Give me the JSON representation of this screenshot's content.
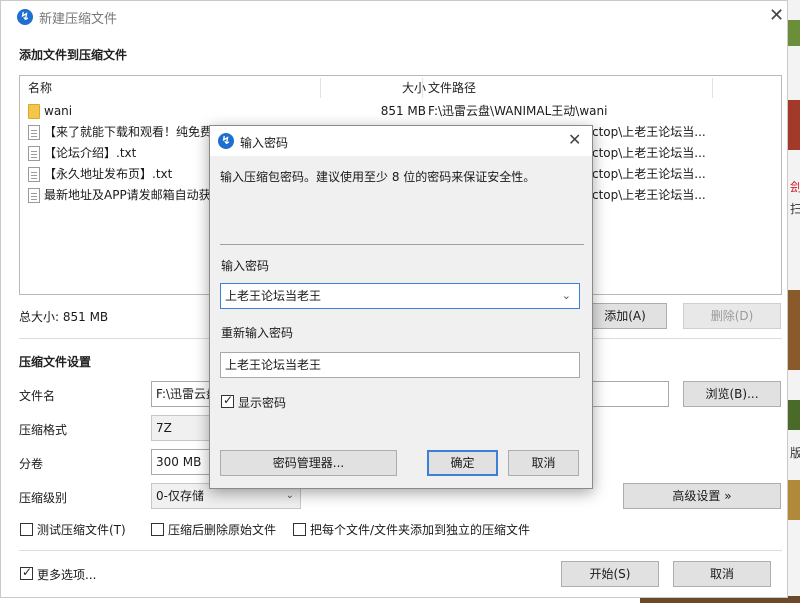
{
  "window": {
    "title": "新建压缩文件",
    "add_section_title": "添加文件到压缩文件"
  },
  "file_list": {
    "columns": [
      "名称",
      "大小",
      "文件路径"
    ],
    "rows": [
      {
        "name": "wani",
        "size": "851 MB",
        "path": "F:\\迅雷云盘\\WANIMAL王动\\wani",
        "type": "folder"
      },
      {
        "name": "【来了就能下载和观看！纯免费",
        "size": "",
        "path": "ctop\\上老王论坛当...",
        "type": "file"
      },
      {
        "name": "【论坛介绍】.txt",
        "size": "",
        "path": "ctop\\上老王论坛当...",
        "type": "file"
      },
      {
        "name": "【永久地址发布页】.txt",
        "size": "",
        "path": "ctop\\上老王论坛当...",
        "type": "file"
      },
      {
        "name": "最新地址及APP请发邮箱自动获",
        "size": "",
        "path": "ctop\\上老王论坛当...",
        "type": "file"
      }
    ]
  },
  "total_size": "总大小: 851 MB",
  "buttons": {
    "add": "添加(A)",
    "delete": "删除(D)",
    "browse": "浏览(B)...",
    "advanced": "高级设置 »",
    "start": "开始(S)",
    "cancel": "取消"
  },
  "settings": {
    "section_title": "压缩文件设置",
    "filename_label": "文件名",
    "filename_value": "F:\\迅雷云盘",
    "format_label": "压缩格式",
    "format_value": "7Z",
    "volume_label": "分卷",
    "volume_value": "300 MB",
    "level_label": "压缩级别",
    "level_value": "0-仅存储"
  },
  "options": {
    "test": {
      "label": "测试压缩文件(T)",
      "checked": false
    },
    "delete_source": {
      "label": "压缩后删除原始文件",
      "checked": false
    },
    "separate": {
      "label": "把每个文件/文件夹添加到独立的压缩文件",
      "checked": false
    },
    "more": {
      "label": "更多选项...",
      "checked": true
    }
  },
  "password_dialog": {
    "title": "输入密码",
    "instruction": "输入压缩包密码。建议使用至少 8 位的密码来保证安全性。",
    "password_label": "输入密码",
    "password_value": "上老王论坛当老王",
    "reenter_label": "重新输入密码",
    "reenter_value": "上老王论坛当老王",
    "show_password_label": "显示密码",
    "show_password_checked": true,
    "manager_button": "密码管理器...",
    "ok_button": "确定",
    "cancel_button": "取消"
  },
  "background": {
    "glyphs": [
      "刽",
      "扫",
      "版"
    ]
  },
  "colors": {
    "accent": "#1f6fd1",
    "dialog_bg": "#f0f0f0",
    "focus_border": "#3c7fd6"
  }
}
